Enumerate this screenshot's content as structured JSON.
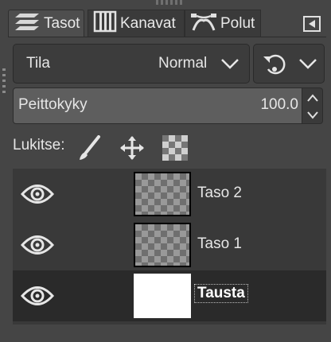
{
  "tabs": [
    {
      "label": "Tasot",
      "icon": "layers-icon",
      "active": true
    },
    {
      "label": "Kanavat",
      "icon": "channels-icon",
      "active": false
    },
    {
      "label": "Polut",
      "icon": "paths-icon",
      "active": false
    }
  ],
  "mode": {
    "label": "Tila",
    "value": "Normal"
  },
  "opacity": {
    "label": "Peittokyky",
    "value": "100.0"
  },
  "lock": {
    "label": "Lukitse:",
    "icons": [
      "lock-pixels-icon",
      "lock-position-icon",
      "lock-alpha-icon"
    ]
  },
  "layers": [
    {
      "name": "Taso 2",
      "visible": true,
      "thumbnail": "transparent",
      "selected": false
    },
    {
      "name": "Taso 1",
      "visible": true,
      "thumbnail": "transparent",
      "selected": false
    },
    {
      "name": "Tausta",
      "visible": true,
      "thumbnail": "white",
      "selected": true
    }
  ],
  "colors": {
    "background": "#454545",
    "panel": "#393939",
    "selected_row": "#2a2a2a"
  }
}
